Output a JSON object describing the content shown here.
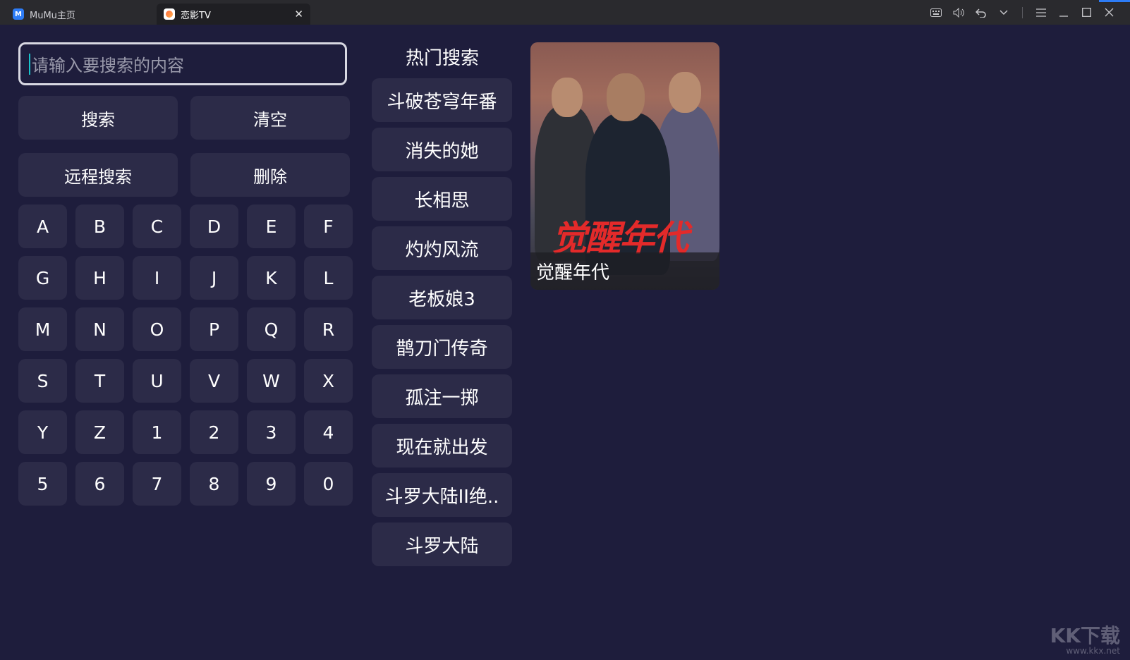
{
  "window": {
    "tabs": [
      {
        "label": "MuMu主页",
        "icon": "mumu-logo-icon"
      },
      {
        "label": "恋影TV",
        "icon": "app-icon",
        "active": true
      }
    ],
    "tab_close": "✕",
    "controls": [
      "keyboard-icon",
      "volume-icon",
      "back-icon",
      "chevron-down-icon",
      "menu-icon",
      "minimize-icon",
      "maximize-icon",
      "close-icon"
    ]
  },
  "search": {
    "placeholder": "请输入要搜索的内容",
    "search_label": "搜索",
    "clear_label": "清空",
    "remote_label": "远程搜索",
    "delete_label": "删除"
  },
  "keyboard": {
    "keys": [
      "A",
      "B",
      "C",
      "D",
      "E",
      "F",
      "G",
      "H",
      "I",
      "J",
      "K",
      "L",
      "M",
      "N",
      "O",
      "P",
      "Q",
      "R",
      "S",
      "T",
      "U",
      "V",
      "W",
      "X",
      "Y",
      "Z",
      "1",
      "2",
      "3",
      "4",
      "5",
      "6",
      "7",
      "8",
      "9",
      "0"
    ]
  },
  "hot": {
    "title": "热门搜索",
    "items": [
      "斗破苍穹年番",
      "消失的她",
      "长相思",
      "灼灼风流",
      "老板娘3",
      "鹊刀门传奇",
      "孤注一掷",
      "现在就出发",
      "斗罗大陆II绝..",
      "斗罗大陆"
    ]
  },
  "result": {
    "title": "觉醒年代",
    "art_text": "觉醒年代"
  },
  "watermark": {
    "main": "KK下载",
    "sub": "www.kkx.net"
  },
  "colors": {
    "background": "#1e1d3c",
    "button": "#2c2b48",
    "accent": "#18c2c9"
  }
}
